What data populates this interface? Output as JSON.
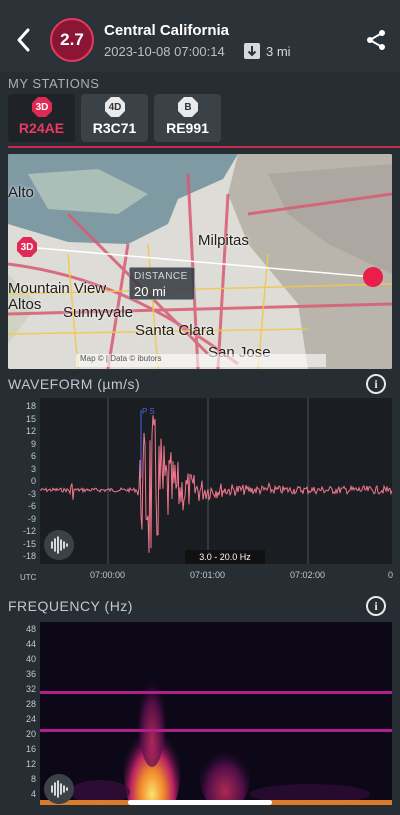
{
  "header": {
    "magnitude": "2.7",
    "title": "Central California",
    "datetime": "2023-10-08 07:00:14",
    "distance": "3 mi"
  },
  "stations": {
    "section_label": "MY STATIONS",
    "items": [
      {
        "badge": "3D",
        "name": "R24AE",
        "active": true
      },
      {
        "badge": "4D",
        "name": "R3C71",
        "active": false
      },
      {
        "badge": "B",
        "name": "RE991",
        "active": false
      }
    ]
  },
  "map": {
    "labels": [
      "Alto",
      "Milpitas",
      "Mountain View",
      "Altos",
      "Sunnyvale",
      "Santa Clara",
      "San Jose"
    ],
    "station_badge": "3D",
    "distance_label": "DISTANCE",
    "distance_value": "20 mi",
    "attribution": "Map ©                 | Data ©                    ibutors"
  },
  "waveform": {
    "title": "WAVEFORM (µm/s)",
    "y_ticks": [
      "18",
      "15",
      "12",
      "9",
      "6",
      "3",
      "0",
      "-3",
      "-6",
      "-9",
      "-12",
      "-15",
      "-18"
    ],
    "x_ticks": [
      "07:00:00",
      "07:01:00",
      "07:02:00",
      "0"
    ],
    "utc_label": "UTC",
    "pick_label": "P S",
    "filter_label": "3.0 - 20.0 Hz",
    "colors": {
      "trace": "#f2778f",
      "pick": "#4a63d8"
    }
  },
  "frequency": {
    "title": "FREQUENCY (Hz)",
    "y_ticks": [
      "48",
      "44",
      "40",
      "36",
      "32",
      "28",
      "24",
      "20",
      "16",
      "12",
      "8",
      "4"
    ],
    "colors": {
      "band": "#b0208c",
      "hot": "#f7d24a"
    }
  },
  "icons": {
    "back": "chevron-left-icon",
    "share": "share-icon",
    "info": "info-icon",
    "sound": "sound-wave-icon"
  }
}
